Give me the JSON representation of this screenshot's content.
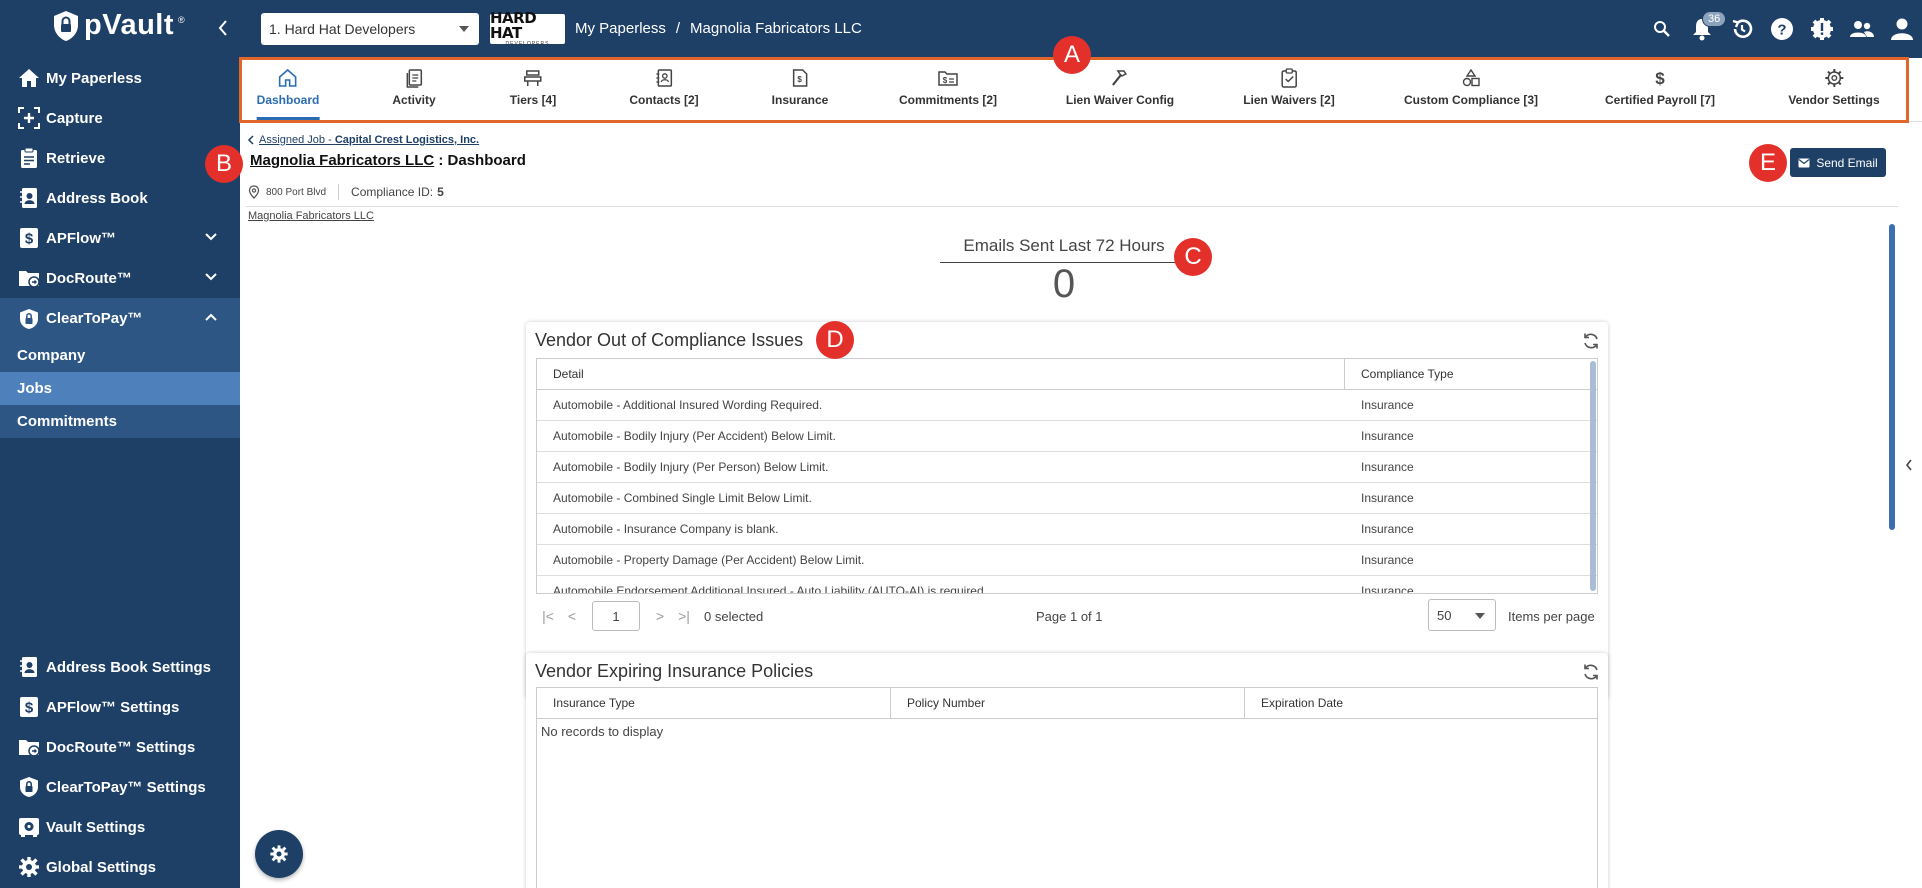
{
  "app": {
    "logo_text": "pVault",
    "trademark": "®"
  },
  "header": {
    "job_select_value": "1. Hard Hat Developers",
    "company_logo": {
      "big": "HARD HAT",
      "small": "DEVELOPERS"
    },
    "breadcrumb": [
      "My Paperless",
      "/",
      "Magnolia Fabricators LLC"
    ],
    "notification_count": "36"
  },
  "sidebar": {
    "items": [
      {
        "label": "My Paperless",
        "icon": "home-icon"
      },
      {
        "label": "Capture",
        "icon": "capture-icon"
      },
      {
        "label": "Retrieve",
        "icon": "clipboard-icon"
      },
      {
        "label": "Address Book",
        "icon": "address-book-icon"
      },
      {
        "label": "APFlow™",
        "icon": "dollar-doc-icon"
      },
      {
        "label": "DocRoute™",
        "icon": "folder-route-icon"
      },
      {
        "label": "ClearToPay™",
        "icon": "shield-lock-icon"
      }
    ],
    "subitems": [
      {
        "label": "Company"
      },
      {
        "label": "Jobs"
      },
      {
        "label": "Commitments"
      }
    ],
    "settings": [
      {
        "label": "Address Book Settings"
      },
      {
        "label": "APFlow™ Settings"
      },
      {
        "label": "DocRoute™ Settings"
      },
      {
        "label": "ClearToPay™ Settings"
      },
      {
        "label": "Vault Settings"
      },
      {
        "label": "Global Settings"
      }
    ]
  },
  "tabs": [
    {
      "label": "Dashboard",
      "icon": "home-icon"
    },
    {
      "label": "Activity",
      "icon": "activity-icon"
    },
    {
      "label": "Tiers [4]",
      "icon": "tiers-icon"
    },
    {
      "label": "Contacts [2]",
      "icon": "contacts-icon"
    },
    {
      "label": "Insurance",
      "icon": "insurance-icon"
    },
    {
      "label": "Commitments [2]",
      "icon": "commitments-icon"
    },
    {
      "label": "Lien Waiver Config",
      "icon": "hammer-icon"
    },
    {
      "label": "Lien Waivers [2]",
      "icon": "clipboard-check-icon"
    },
    {
      "label": "Custom Compliance [3]",
      "icon": "shapes-icon"
    },
    {
      "label": "Certified Payroll [7]",
      "icon": "dollar-icon"
    },
    {
      "label": "Vendor Settings",
      "icon": "gear-icon"
    }
  ],
  "annotations": {
    "a": "A",
    "b": "B",
    "c": "C",
    "d": "D",
    "e": "E"
  },
  "page": {
    "assigned_prefix": "Assigned Job - ",
    "assigned_job": "Capital Crest Logistics, Inc.",
    "vendor_name": "Magnolia Fabricators LLC",
    "title_suffix": " : Dashboard",
    "address": "800 Port Blvd",
    "compliance_label": "Compliance ID:",
    "compliance_id": "5",
    "vendor_link": "Magnolia Fabricators LLC",
    "send_email_label": "Send Email"
  },
  "emails": {
    "title": "Emails Sent Last 72 Hours",
    "count": "0"
  },
  "compliance_issues": {
    "title": "Vendor Out of Compliance Issues",
    "columns": [
      "Detail",
      "Compliance Type"
    ],
    "rows": [
      [
        "Automobile - Additional Insured Wording Required.",
        "Insurance"
      ],
      [
        "Automobile - Bodily Injury (Per Accident) Below Limit.",
        "Insurance"
      ],
      [
        "Automobile - Bodily Injury (Per Person) Below Limit.",
        "Insurance"
      ],
      [
        "Automobile - Combined Single Limit Below Limit.",
        "Insurance"
      ],
      [
        "Automobile - Insurance Company is blank.",
        "Insurance"
      ],
      [
        "Automobile - Property Damage (Per Accident) Below Limit.",
        "Insurance"
      ],
      [
        "Automobile Endorsement Additional Insured - Auto Liability (AUTO-AI) is required",
        "Insurance"
      ]
    ],
    "pager": {
      "page_input": "1",
      "selected": "0 selected",
      "page_info": "Page 1 of 1",
      "per_page": "50",
      "per_page_label": "Items per page"
    }
  },
  "expiring_policies": {
    "title": "Vendor Expiring Insurance Policies",
    "columns": [
      "Insurance Type",
      "Policy Number",
      "Expiration Date"
    ],
    "empty_text": "No records to display"
  }
}
